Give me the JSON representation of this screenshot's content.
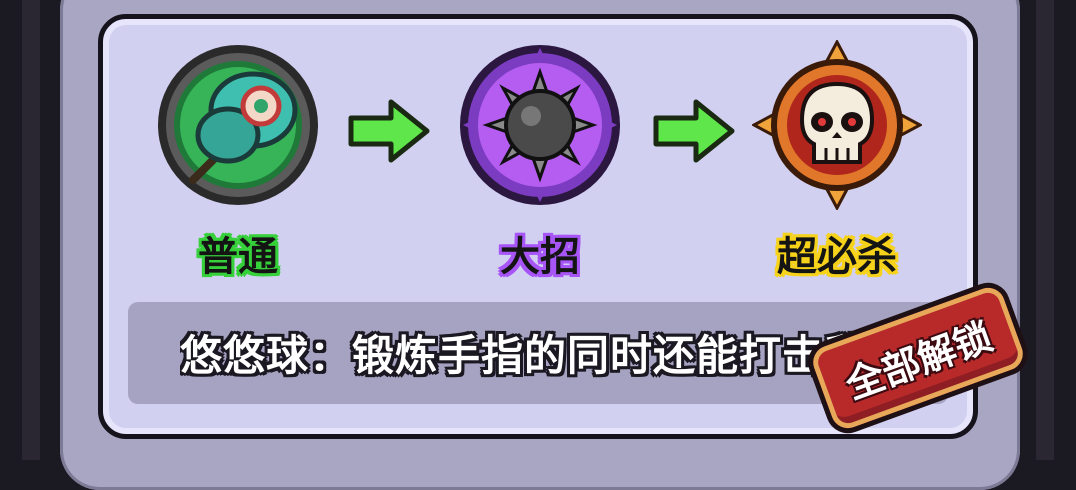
{
  "stages": [
    {
      "label": "普通",
      "label_color": "#36d03a",
      "icon": "yoyo-icon"
    },
    {
      "label": "大招",
      "label_color": "#a855f7",
      "icon": "spiked-ball-icon"
    },
    {
      "label": "超必杀",
      "label_color": "#f6d21a",
      "icon": "skull-icon"
    }
  ],
  "description": "悠悠球：锻炼手指的同时还能打击敌人",
  "unlock_badge": "全部解锁",
  "colors": {
    "card_bg": "#d1d0f0",
    "desc_bar": "#a6a3c2",
    "arrow_green": "#5ee64a",
    "badge_red": "#b82a2a"
  }
}
